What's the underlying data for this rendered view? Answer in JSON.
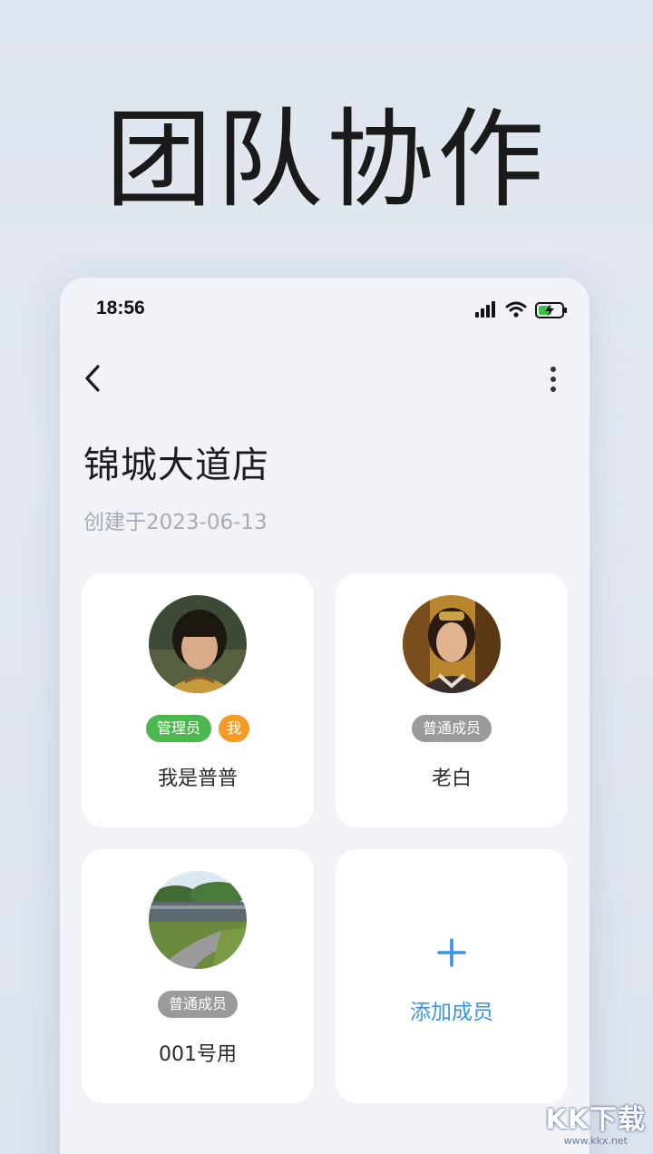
{
  "hero": {
    "title": "团队协作"
  },
  "status_bar": {
    "time": "18:56"
  },
  "header": {
    "back_icon": "chevron-left-icon",
    "more_icon": "more-vertical-icon"
  },
  "store": {
    "name": "锦城大道店",
    "created": "创建于2023-06-13"
  },
  "members": [
    {
      "name": "我是普普",
      "badges": [
        "管理员",
        "我"
      ]
    },
    {
      "name": "老白",
      "badges": [
        "普通成员"
      ]
    },
    {
      "name": "001号用",
      "badges": [
        "普通成员"
      ]
    }
  ],
  "add_member": {
    "label": "添加成员",
    "icon": "plus-icon"
  },
  "colors": {
    "admin_badge": "#4cb84f",
    "me_badge": "#f59a23",
    "member_badge": "#9a9a9a",
    "accent": "#3a93e6"
  },
  "watermark": {
    "main": "KK下载",
    "sub": "www.kkx.net"
  }
}
